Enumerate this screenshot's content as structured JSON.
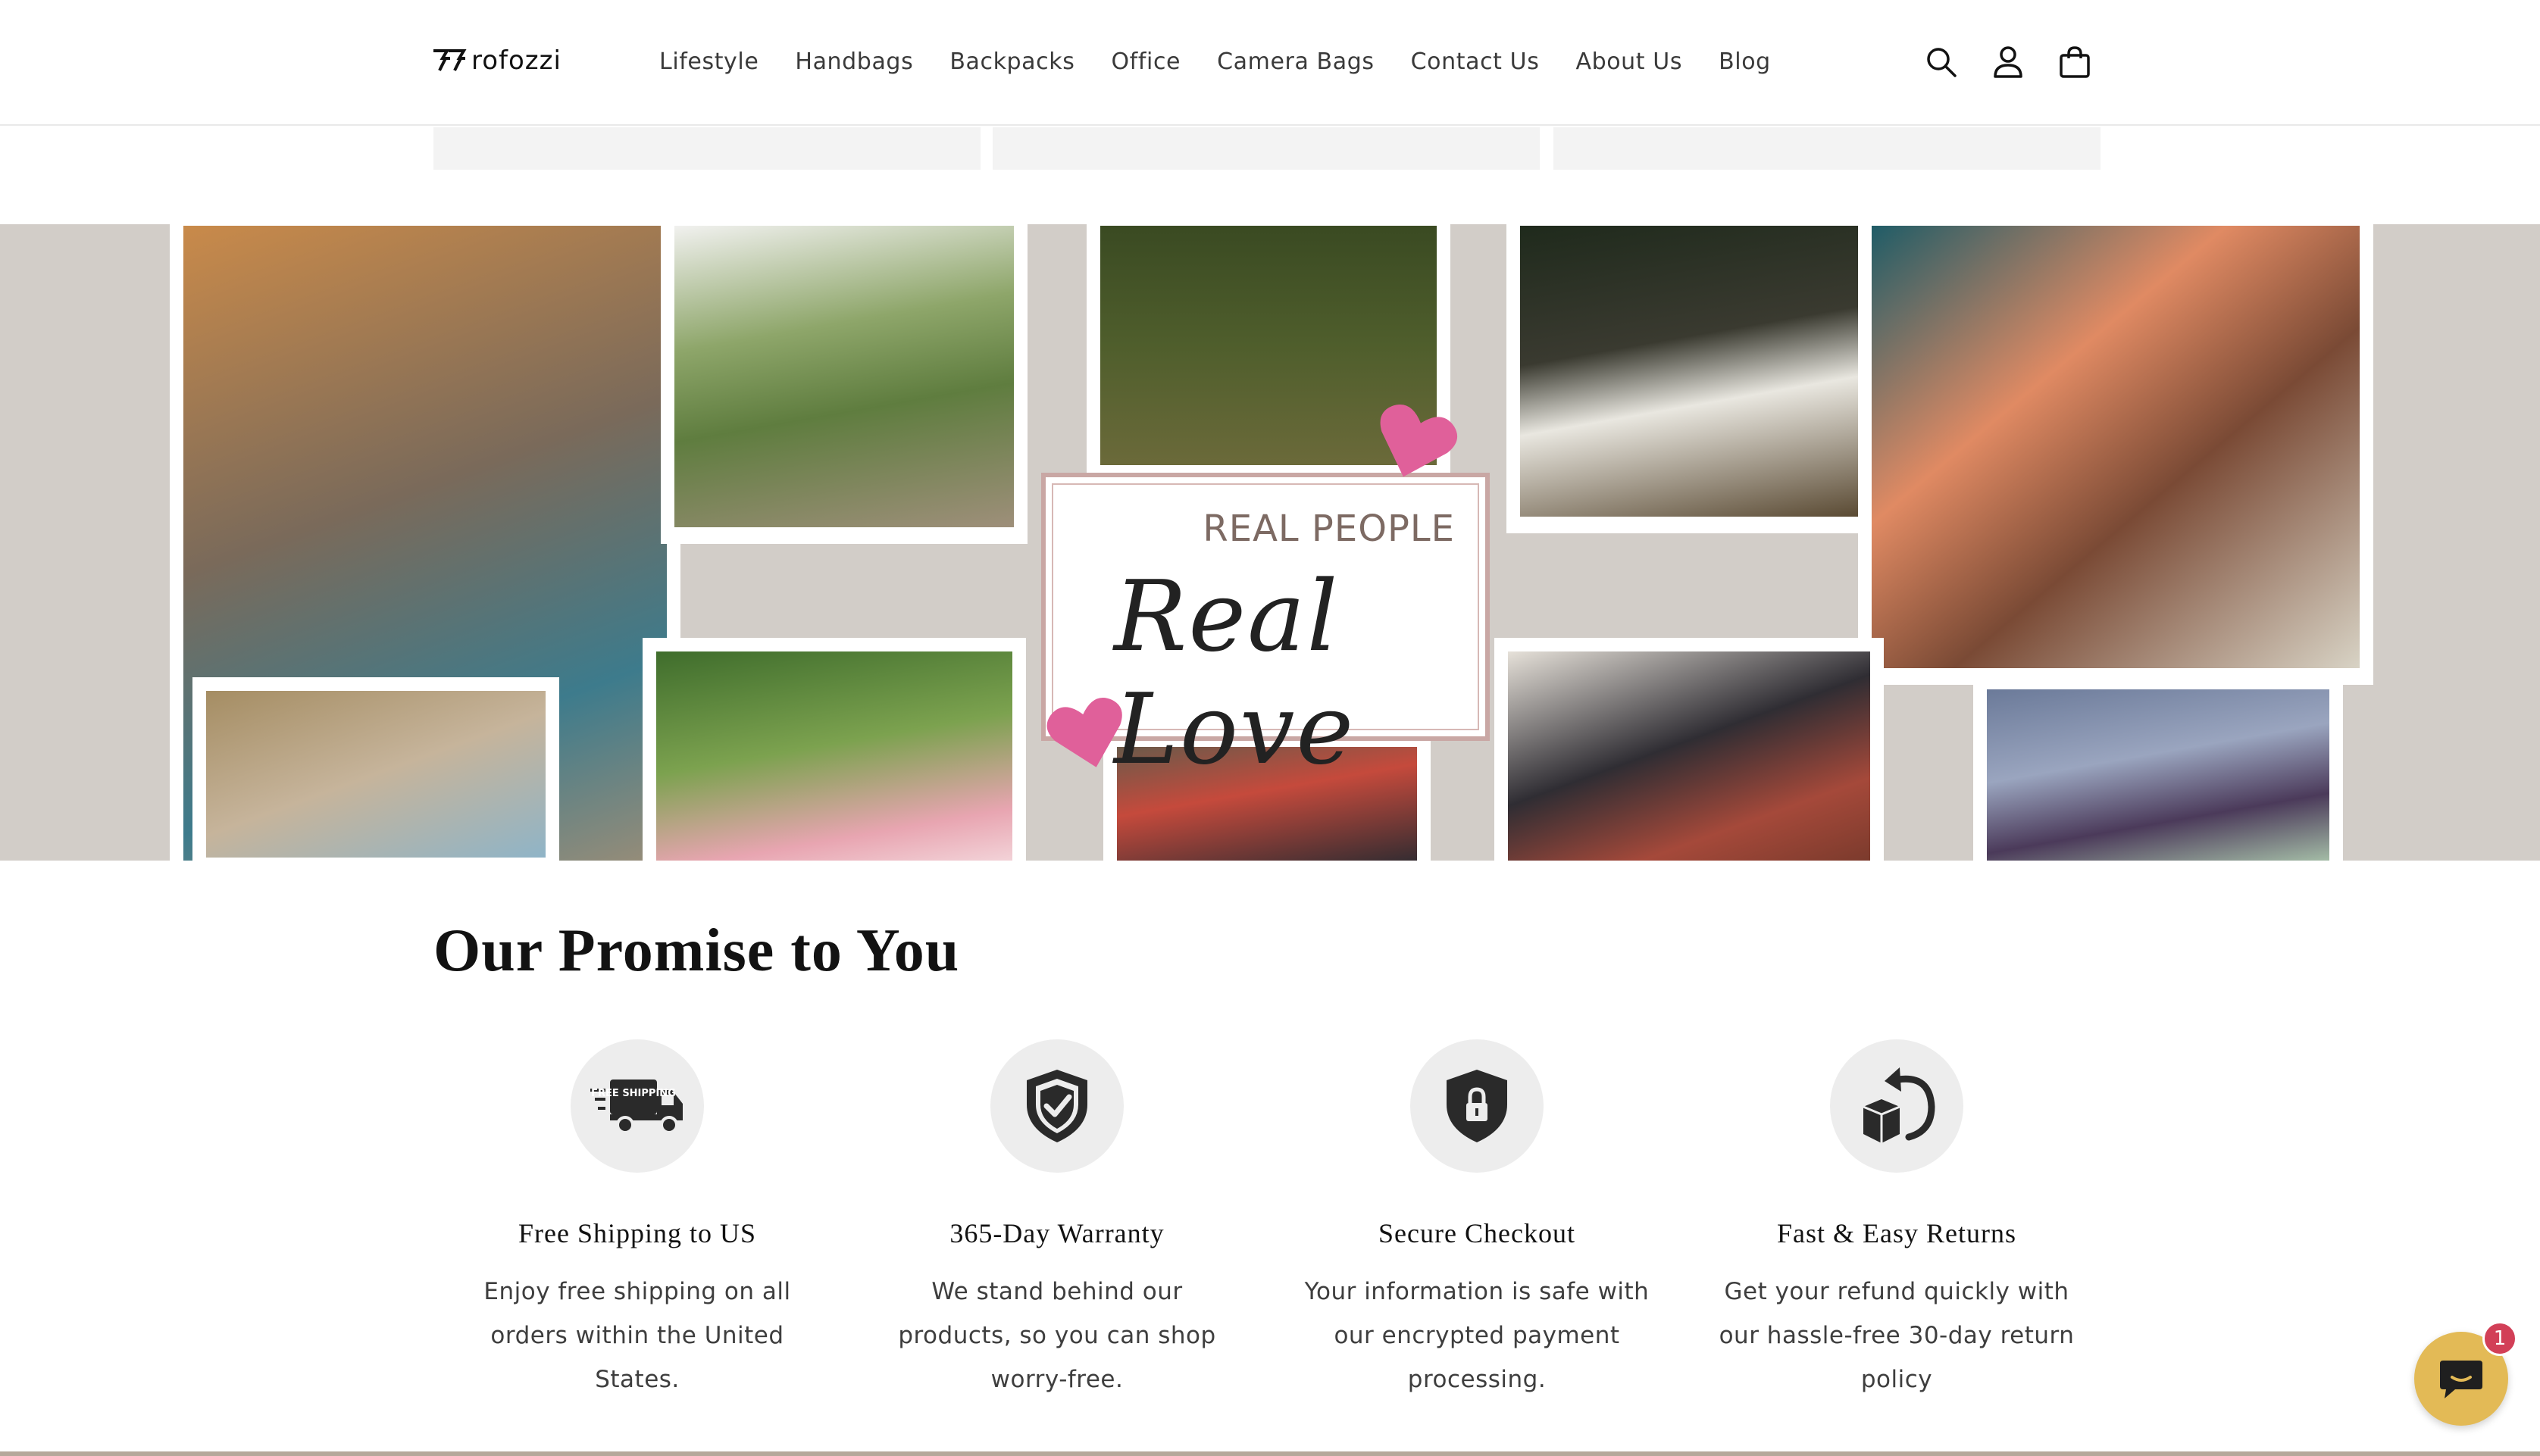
{
  "header": {
    "logo_text": "rofozzi",
    "nav": [
      "Lifestyle",
      "Handbags",
      "Backpacks",
      "Office",
      "Camera Bags",
      "Contact Us",
      "About Us",
      "Blog"
    ],
    "icons": [
      "search-icon",
      "account-icon",
      "cart-icon"
    ]
  },
  "banner": {
    "kicker": "REAL PEOPLE",
    "headline": "Real Love",
    "accent": "#e0609a"
  },
  "promise": {
    "title": "Our Promise to You",
    "items": [
      {
        "icon": "free-shipping-truck-icon",
        "icon_text": "FREE SHIPPING",
        "title": "Free Shipping to US",
        "text": "Enjoy free shipping on all orders within the United States."
      },
      {
        "icon": "shield-check-icon",
        "title": "365-Day Warranty",
        "text": "We stand behind our products, so you can shop worry-free."
      },
      {
        "icon": "shield-lock-icon",
        "title": "Secure Checkout",
        "text": "Your information is safe with our encrypted payment processing."
      },
      {
        "icon": "return-box-icon",
        "title": "Fast & Easy Returns",
        "text": "Get your refund quickly with our hassle-free 30-day return policy"
      }
    ]
  },
  "chat": {
    "badge_count": "1",
    "color": "#e3ba56"
  }
}
